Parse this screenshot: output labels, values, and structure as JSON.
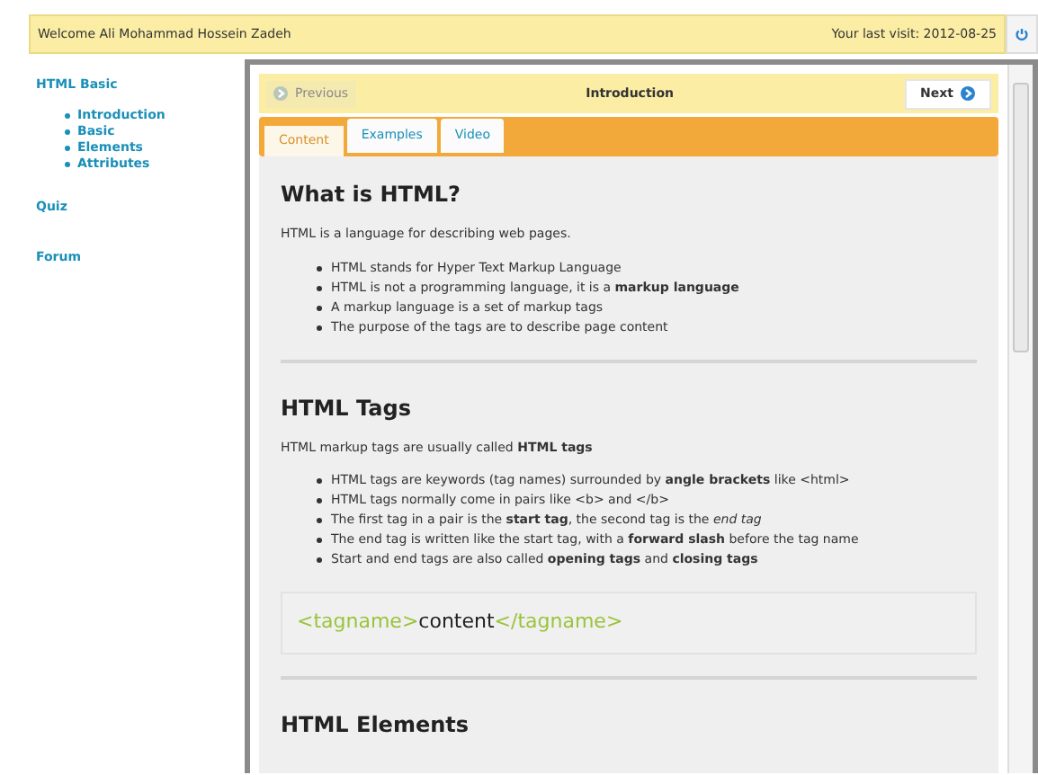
{
  "header": {
    "welcome": "Welcome Ali Mohammad Hossein Zadeh",
    "last_visit": "Your last visit: 2012-08-25"
  },
  "sidebar": {
    "sections": [
      {
        "label": "HTML Basic",
        "children": [
          {
            "label": "Introduction"
          },
          {
            "label": "Basic"
          },
          {
            "label": "Elements"
          },
          {
            "label": "Attributes"
          }
        ]
      },
      {
        "label": "Quiz"
      },
      {
        "label": "Forum"
      }
    ]
  },
  "nav": {
    "previous": {
      "label": "Previous",
      "disabled": true
    },
    "title": "Introduction",
    "next": {
      "label": "Next",
      "disabled": false
    }
  },
  "tabs": [
    {
      "label": "Content",
      "selected": true
    },
    {
      "label": "Examples",
      "selected": false
    },
    {
      "label": "Video",
      "selected": false
    }
  ],
  "sections": [
    {
      "heading": "What is HTML?",
      "intro": "HTML is a language for describing web pages.",
      "bullets": [
        "HTML stands for Hyper Text Markup Language",
        "HTML is not a programming language, it is a **markup language**",
        "A markup language is a set of markup tags",
        "The purpose of the tags are to describe page content"
      ]
    },
    {
      "heading": "HTML Tags",
      "intro": "HTML markup tags are usually called **HTML tags**",
      "bullets": [
        "HTML tags are keywords (tag names) surrounded by **angle brackets** like <html>",
        "HTML tags normally come in pairs like <b> and </b>",
        "The first tag in a pair is the **start tag**, the second tag is the *end tag*",
        "The end tag is written like the start tag, with a **forward slash** before the tag name",
        "Start and end tags are also called **opening tags** and **closing tags**"
      ],
      "code": [
        {
          "kind": "tag",
          "text": "<tagname>"
        },
        {
          "kind": "content",
          "text": "content"
        },
        {
          "kind": "tag",
          "text": "</tagname>"
        }
      ]
    },
    {
      "heading": "HTML Elements"
    }
  ]
}
